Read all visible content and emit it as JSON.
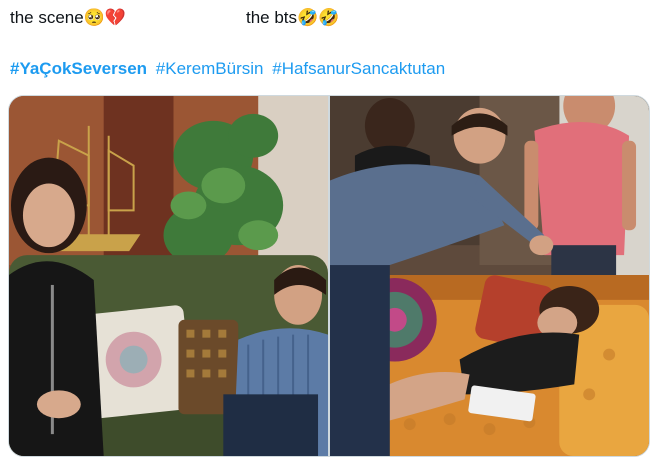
{
  "tweet": {
    "caption_left": "the scene🥺💔",
    "caption_right": "the bts🤣🤣",
    "hashtags": [
      "#YaÇokSeversen",
      "#KeremBürsin",
      "#HafsanurSancaktutan"
    ]
  },
  "media": {
    "left_image": "scene-still-couple-on-green-sofa",
    "right_image": "bts-photo-actor-sleeping-on-orange-sofa"
  },
  "colors": {
    "hashtag": "#1d9bf0",
    "text": "#0f1419",
    "border": "#cfd9de"
  }
}
